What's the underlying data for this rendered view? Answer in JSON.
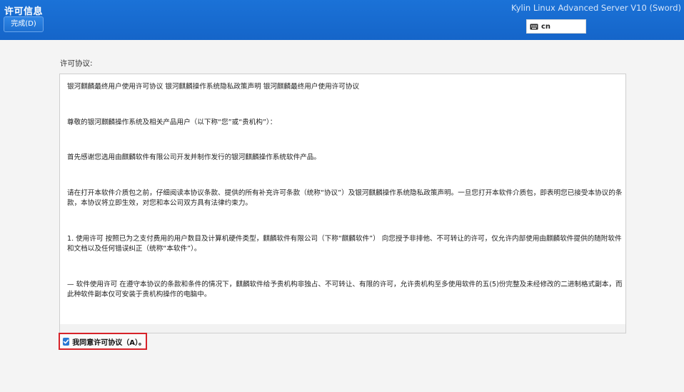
{
  "header": {
    "title": "许可信息",
    "done_label": "完成(D)",
    "product_name": "Kylin Linux Advanced Server V10 (Sword)",
    "keyboard_layout": "cn",
    "accent_color": "#1b72d7"
  },
  "license": {
    "section_label": "许可协议:",
    "paragraphs": [
      "银河麒麟最终用户使用许可协议 银河麒麟操作系统隐私政策声明 银河麒麟最终用户使用许可协议",
      "尊敬的银河麒麟操作系统及相关产品用户（以下称“您”或“贵机构”）：",
      "首先感谢您选用由麒麟软件有限公司开发并制作发行的银河麒麟操作系统软件产品。",
      "请在打开本软件介质包之前，仔细阅读本协议条款、提供的所有补充许可条款（统称“协议”）及银河麒麟操作系统隐私政策声明。一旦您打开本软件介质包，即表明您已接受本协议的条款，本协议将立即生效，对您和本公司双方具有法律约束力。",
      "1. 使用许可 按照已为之支付费用的用户数目及计算机硬件类型，麒麟软件有限公司（下称“麒麟软件”） 向您授予非排他、不可转让的许可，仅允许内部使用由麒麟软件提供的随附软件和文档以及任何错误纠正（统称“本软件”）。",
      "— 软件使用许可 在遵守本协议的条款和条件的情况下，麒麟软件给予贵机构非独占、不可转让、有限的许可，允许贵机构至多使用软件的五(5)份完整及未经修改的二进制格式副本，而此种软件副本仅可安装于贵机构操作的电脑中。"
    ]
  },
  "agree": {
    "label": "我同意许可协议（A）。",
    "checked": true,
    "highlight_color": "#d7232a"
  },
  "icons": {
    "keyboard": "keyboard-icon",
    "checkbox": "checkmark-icon"
  }
}
